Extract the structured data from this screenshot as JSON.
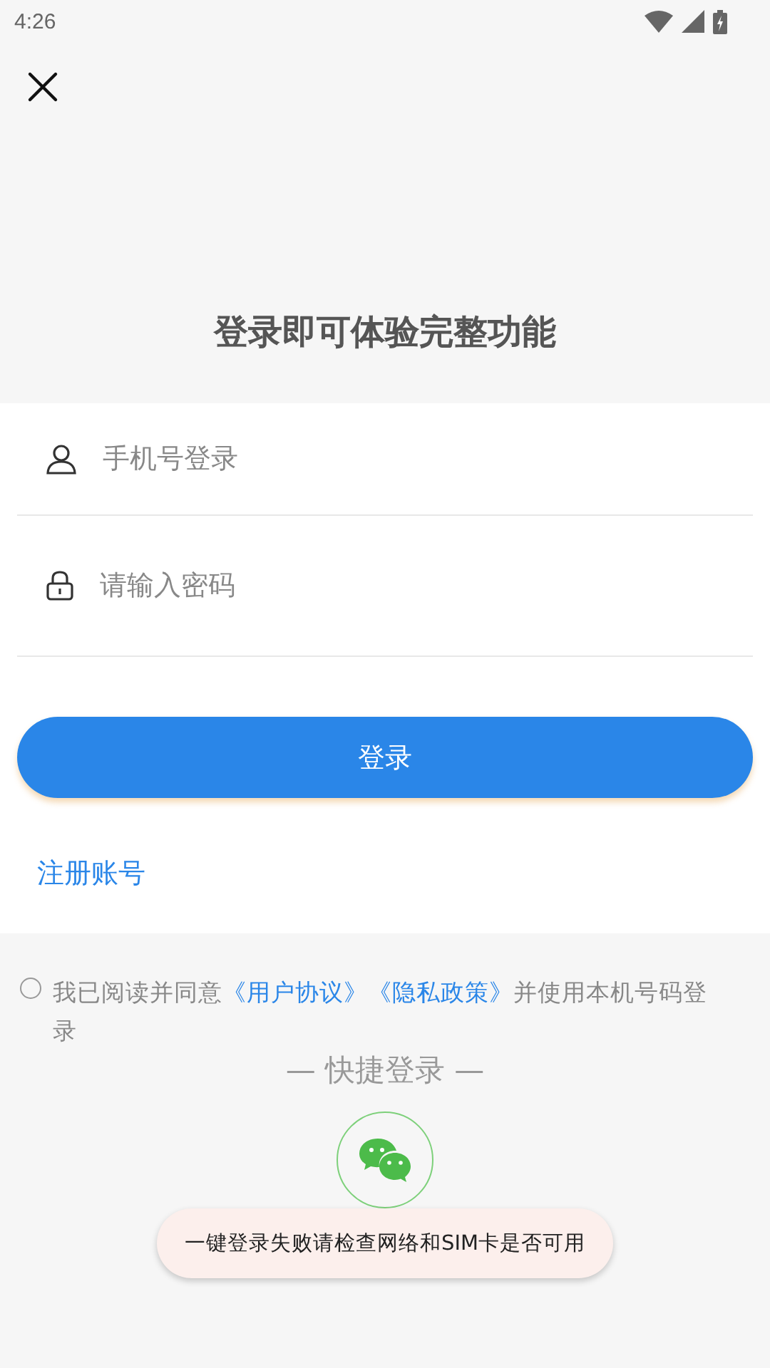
{
  "status_bar": {
    "time": "4:26"
  },
  "title": "登录即可体验完整功能",
  "fields": [
    {
      "kind": "phone",
      "placeholder": "手机号登录"
    },
    {
      "kind": "password",
      "placeholder": "请输入密码"
    }
  ],
  "login_button": "登录",
  "register_link": "注册账号",
  "agreement": {
    "checked": false,
    "parts": [
      {
        "kind": "text",
        "text": "我已阅读并同意"
      },
      {
        "kind": "link",
        "text": "《用户协议》"
      },
      {
        "kind": "link",
        "text": "《隐私政策》"
      },
      {
        "kind": "text",
        "text": "并使用本机号码登录"
      }
    ]
  },
  "quick_login": {
    "title": "— 快捷登录 —"
  },
  "toast": "一键登录失败请检查网络和SIM卡是否可用"
}
